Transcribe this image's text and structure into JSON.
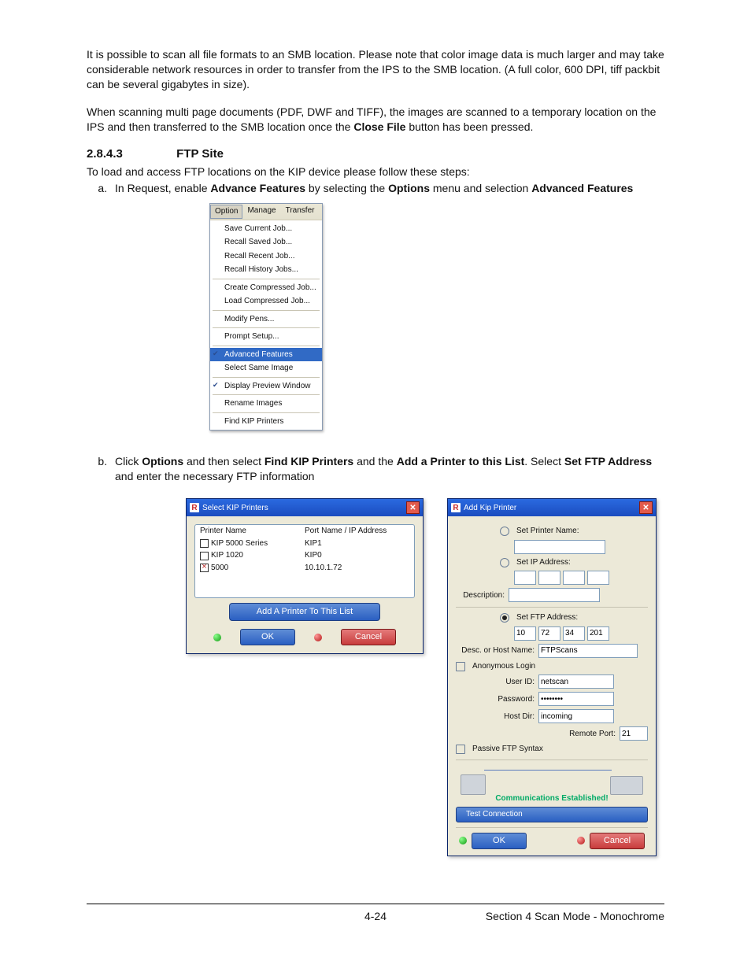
{
  "body": {
    "p1_a": "It is possible to scan all file formats to an SMB location.  Please note that color image data is much larger and may take considerable network resources in order to transfer from the IPS to the SMB location. (A full color, 600 DPI, tiff packbit can be several gigabytes in size).",
    "p2_a": "When scanning multi page documents (PDF, DWF and TIFF), the images are scanned to a temporary location on the IPS and then transferred to the SMB location once the ",
    "p2_b": "Close File",
    "p2_c": " button has been pressed."
  },
  "section": {
    "num": "2.8.4.3",
    "title": "FTP Site"
  },
  "intro": "To load and access FTP locations on the KIP device please follow these steps:",
  "step_a": {
    "t1": "In Request, enable ",
    "b1": "Advance Features",
    "t2": " by selecting the ",
    "b2": "Options",
    "t3": " menu and selection ",
    "b3": "Advanced Features"
  },
  "step_b": {
    "t1": "Click ",
    "b1": "Options",
    "t2": " and then select ",
    "b2": "Find KIP Printers",
    "t3": " and the ",
    "b3": "Add a Printer to this List",
    "t4": ". Select ",
    "b4": "Set FTP Address",
    "t5": " and enter the necessary FTP information"
  },
  "menu": {
    "bar": [
      "Option",
      "Manage",
      "Transfer"
    ],
    "items": [
      {
        "label": "Save Current Job...",
        "sepAfter": false
      },
      {
        "label": "Recall Saved Job...",
        "sepAfter": false
      },
      {
        "label": "Recall Recent Job...",
        "sepAfter": false
      },
      {
        "label": "Recall History Jobs...",
        "sepAfter": true
      },
      {
        "label": "Create Compressed Job...",
        "sepAfter": false
      },
      {
        "label": "Load Compressed Job...",
        "sepAfter": true
      },
      {
        "label": "Modify Pens...",
        "sepAfter": true
      },
      {
        "label": "Prompt Setup...",
        "sepAfter": true
      },
      {
        "label": "Advanced Features",
        "checked": true,
        "highlight": true,
        "sepAfter": false
      },
      {
        "label": "Select Same Image",
        "sepAfter": true
      },
      {
        "label": "Display Preview Window",
        "checked": true,
        "sepAfter": true
      },
      {
        "label": "Rename Images",
        "sepAfter": true
      },
      {
        "label": "Find KIP Printers",
        "sepAfter": false
      }
    ]
  },
  "selectWin": {
    "title": "Select KIP Printers",
    "headers": [
      "Printer Name",
      "Port Name / IP Address"
    ],
    "rows": [
      {
        "name": "KIP 5000 Series",
        "port": "KIP1",
        "x": false
      },
      {
        "name": "KIP 1020",
        "port": "KIP0",
        "x": false
      },
      {
        "name": "5000",
        "port": "10.10.1.72",
        "x": true
      }
    ],
    "addBtn": "Add A Printer To This List",
    "ok": "OK",
    "cancel": "Cancel"
  },
  "addWin": {
    "title": "Add Kip Printer",
    "setPrinterName": "Set Printer Name:",
    "setIpAddress": "Set IP Address:",
    "description": "Description:",
    "setFtp": "Set FTP Address:",
    "ftp_ip": [
      "10",
      "72",
      "34",
      "201"
    ],
    "descHost": "Desc. or Host Name:",
    "descHostVal": "FTPScans",
    "anon": "Anonymous Login",
    "userId": "User ID:",
    "userIdVal": "netscan",
    "password": "Password:",
    "passwordVal": "••••••••",
    "hostDir": "Host Dir:",
    "hostDirVal": "incoming",
    "remotePort": "Remote Port:",
    "remotePortVal": "21",
    "passive": "Passive FTP Syntax",
    "commStatus": "Communications Established!",
    "test": "Test Connection",
    "ok": "OK",
    "cancel": "Cancel"
  },
  "footer": {
    "page": "4-24",
    "section": "Section 4     Scan Mode - Monochrome"
  }
}
